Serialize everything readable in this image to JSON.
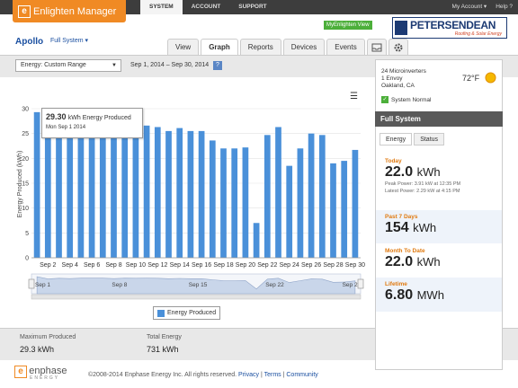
{
  "header": {
    "app_title": "Enlighten Manager",
    "logo_letter": "[e]",
    "nav": [
      "SYSTEM",
      "ACCOUNT",
      "SUPPORT"
    ],
    "my_account": "My Account ▾",
    "help": "Help ?",
    "myenlighten": "MyEnlighten View",
    "installer_name": "PETERSENDEAN",
    "installer_tagline": "Roofing & Solar Energy"
  },
  "site": {
    "name": "Apollo",
    "system_select": "Full System ▾"
  },
  "tabs": [
    "View",
    "Graph",
    "Reports",
    "Devices",
    "Events"
  ],
  "toolbar": {
    "energy_select": "Energy: Custom Range",
    "date_range": "Sep 1, 2014 – Sep 30, 2014",
    "help": "?"
  },
  "tooltip": {
    "value": "29.30",
    "unit": "kWh Energy Produced",
    "date": "Mon Sep 1 2014"
  },
  "chart_data": {
    "type": "bar",
    "ylabel": "Energy Produced (kWh)",
    "ylim": [
      0,
      30
    ],
    "yticks": [
      0,
      5,
      10,
      15,
      20,
      25,
      30
    ],
    "xtick_labels": [
      "Sep 2",
      "Sep 4",
      "Sep 6",
      "Sep 8",
      "Sep 10",
      "Sep 12",
      "Sep 14",
      "Sep 16",
      "Sep 18",
      "Sep 20",
      "Sep 22",
      "Sep 24",
      "Sep 26",
      "Sep 28",
      "Sep 30"
    ],
    "categories": [
      "Sep 1",
      "Sep 2",
      "Sep 3",
      "Sep 4",
      "Sep 5",
      "Sep 6",
      "Sep 7",
      "Sep 8",
      "Sep 9",
      "Sep 10",
      "Sep 11",
      "Sep 12",
      "Sep 13",
      "Sep 14",
      "Sep 15",
      "Sep 16",
      "Sep 17",
      "Sep 18",
      "Sep 19",
      "Sep 20",
      "Sep 21",
      "Sep 22",
      "Sep 23",
      "Sep 24",
      "Sep 25",
      "Sep 26",
      "Sep 27",
      "Sep 28",
      "Sep 29",
      "Sep 30"
    ],
    "series": [
      {
        "name": "Energy Produced",
        "values": [
          29.3,
          25.0,
          26.3,
          25.8,
          26.6,
          26.6,
          26.6,
          25.8,
          26.6,
          26.3,
          26.6,
          26.3,
          25.5,
          26.1,
          25.5,
          25.5,
          23.6,
          22.0,
          22.0,
          22.2,
          7.0,
          24.7,
          26.3,
          18.5,
          22.0,
          25.0,
          24.7,
          19.0,
          19.5,
          21.7
        ]
      }
    ],
    "navigator_labels": [
      "Sep 1",
      "Sep 8",
      "Sep 15",
      "Sep 22",
      "Sep 29"
    ],
    "color": "#4a90d9",
    "legend": "bottom-center"
  },
  "legend_label": "Energy Produced",
  "summary": {
    "max_label": "Maximum Produced",
    "max_value": "29.3",
    "max_unit": "kWh",
    "total_label": "Total Energy",
    "total_value": "731",
    "total_unit": "kWh"
  },
  "panel": {
    "microinverters": "24 Microinverters",
    "envoy": "1 Envoy",
    "location": "Oakland, CA",
    "temperature": "72°F",
    "status": "System Normal",
    "title": "Full System",
    "tabs": [
      "Energy",
      "Status"
    ],
    "today_label": "Today",
    "today_value": "22.0",
    "today_unit": "kWh",
    "peak_power": "Peak Power: 3.91 kW at 12:35 PM",
    "latest_power": "Latest Power: 2.29 kW at 4:15 PM",
    "week_label": "Past 7 Days",
    "week_value": "154",
    "week_unit": "kWh",
    "month_label": "Month To Date",
    "month_value": "22.0",
    "month_unit": "kWh",
    "lifetime_label": "Lifetime",
    "lifetime_value": "6.80",
    "lifetime_unit": "MWh"
  },
  "footer": {
    "brand": "enphase",
    "brand_sub": "ENERGY",
    "copyright": "©2008-2014 Enphase Energy Inc. All rights reserved.",
    "privacy": "Privacy",
    "terms": "Terms",
    "community": "Community"
  }
}
